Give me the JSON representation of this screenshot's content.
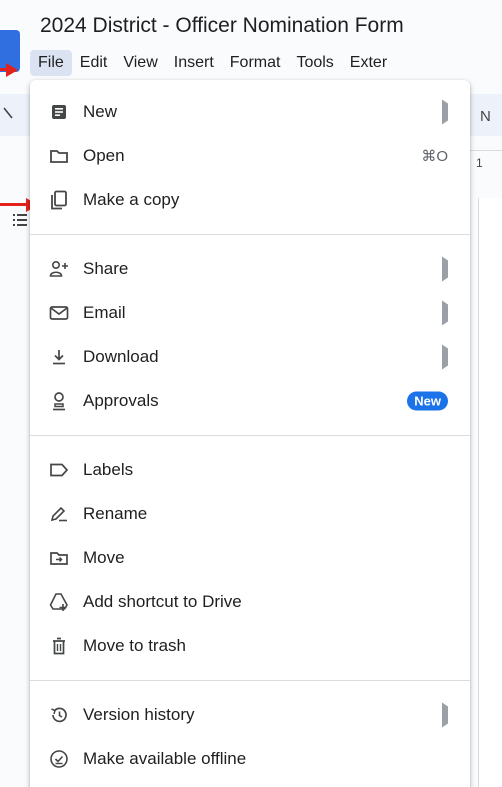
{
  "document": {
    "title": "2024 District - Officer Nomination Form"
  },
  "menubar": [
    "File",
    "Edit",
    "View",
    "Insert",
    "Format",
    "Tools",
    "Exter"
  ],
  "file_menu": {
    "groups": [
      [
        {
          "label": "New",
          "icon": "doc-icon",
          "submenu": true
        },
        {
          "label": "Open",
          "icon": "folder-icon",
          "shortcut": "⌘O"
        },
        {
          "label": "Make a copy",
          "icon": "copy-icon"
        }
      ],
      [
        {
          "label": "Share",
          "icon": "person-add-icon",
          "submenu": true
        },
        {
          "label": "Email",
          "icon": "mail-icon",
          "submenu": true
        },
        {
          "label": "Download",
          "icon": "download-icon",
          "submenu": true
        },
        {
          "label": "Approvals",
          "icon": "approval-icon",
          "badge": "New"
        }
      ],
      [
        {
          "label": "Labels",
          "icon": "label-icon"
        },
        {
          "label": "Rename",
          "icon": "rename-icon"
        },
        {
          "label": "Move",
          "icon": "move-icon"
        },
        {
          "label": "Add shortcut to Drive",
          "icon": "drive-shortcut-icon"
        },
        {
          "label": "Move to trash",
          "icon": "trash-icon"
        }
      ],
      [
        {
          "label": "Version history",
          "icon": "history-icon",
          "submenu": true
        },
        {
          "label": "Make available offline",
          "icon": "offline-icon"
        }
      ]
    ]
  },
  "background_glyphs": {
    "toolbar_letter": "N",
    "ruler_number": "1"
  },
  "colors": {
    "accent": "#1a73e8",
    "annotation_arrow": "#e3231b",
    "menu_active": "#dbe3f3"
  }
}
